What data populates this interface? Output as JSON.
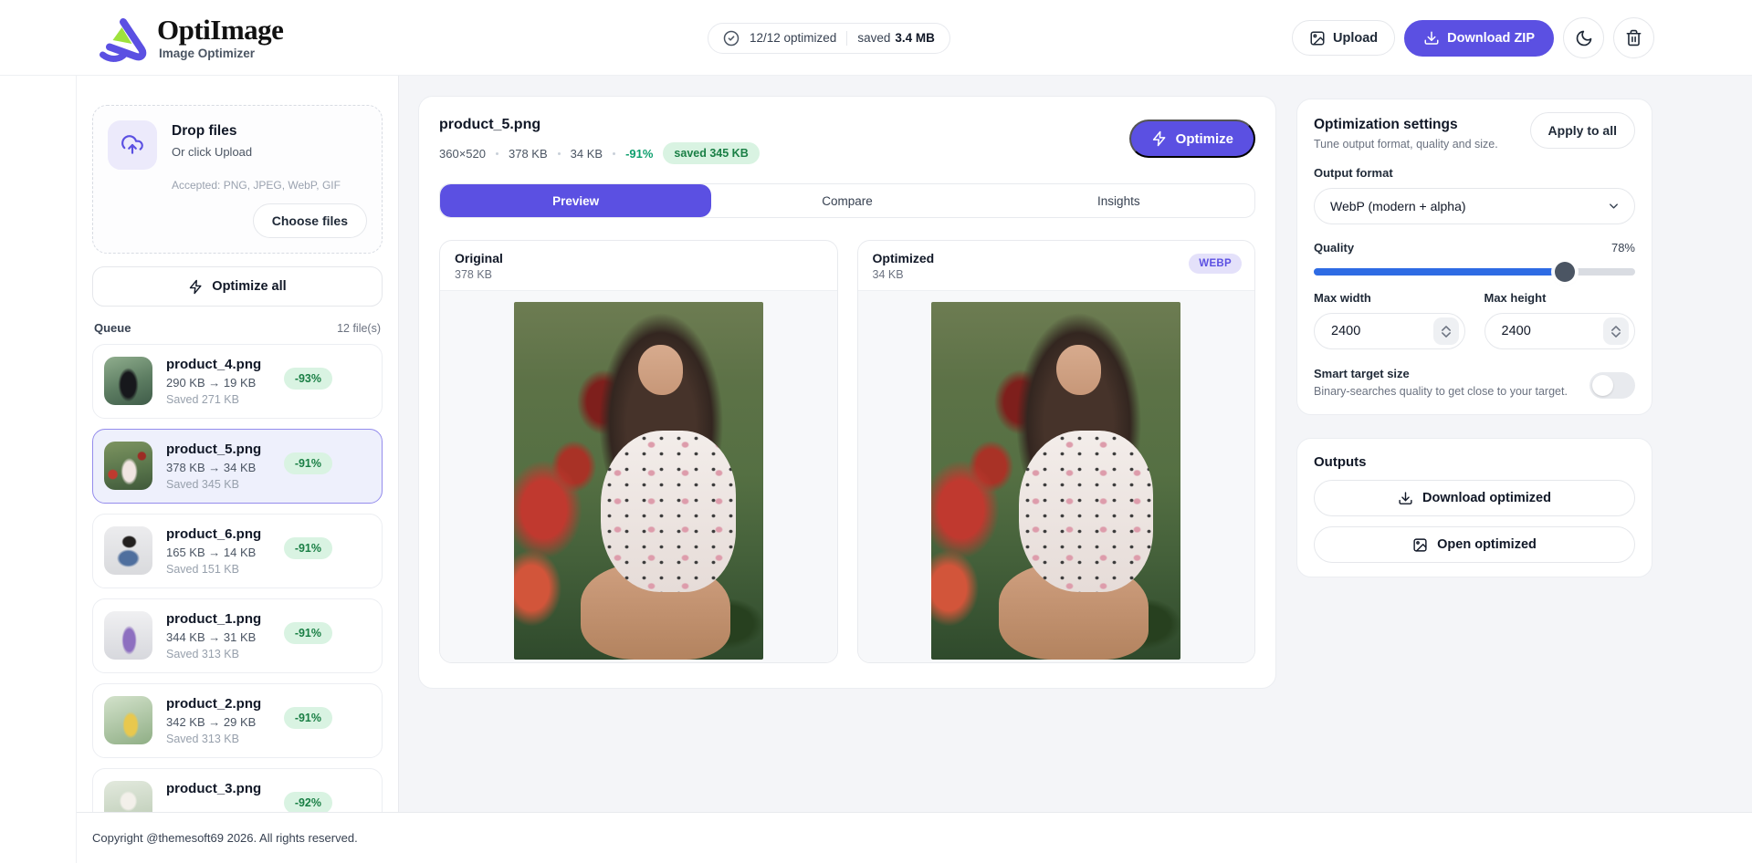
{
  "css_vars": {
    "accent": "#5b50e2",
    "slider-blue": "#2e6be4",
    "green-bg": "#d9f3e2",
    "green-text": "#1a7f45",
    "quality-fill": "78%"
  },
  "header": {
    "logo_title": "OptiImage",
    "logo_subtitle": "Image Optimizer",
    "status_optimized": "12/12 optimized",
    "status_saved_label": "saved",
    "status_saved_value": "3.4 MB",
    "upload_label": "Upload",
    "download_zip_label": "Download ZIP"
  },
  "sidebar": {
    "dropzone": {
      "title": "Drop files",
      "subtitle": "Or click Upload",
      "accepted": "Accepted: PNG, JPEG, WebP, GIF",
      "choose_label": "Choose files"
    },
    "optimize_all_label": "Optimize all",
    "queue": {
      "title": "Queue",
      "count": "12 file(s)",
      "items": [
        {
          "name": "product_4.png",
          "sizes": "290 KB → 19 KB",
          "saved": "Saved 271 KB",
          "badge": "-93%"
        },
        {
          "name": "product_5.png",
          "sizes": "378 KB → 34 KB",
          "saved": "Saved 345 KB",
          "badge": "-91%"
        },
        {
          "name": "product_6.png",
          "sizes": "165 KB → 14 KB",
          "saved": "Saved 151 KB",
          "badge": "-91%"
        },
        {
          "name": "product_1.png",
          "sizes": "344 KB → 31 KB",
          "saved": "Saved 313 KB",
          "badge": "-91%"
        },
        {
          "name": "product_2.png",
          "sizes": "342 KB → 29 KB",
          "saved": "Saved 313 KB",
          "badge": "-91%"
        },
        {
          "name": "product_3.png",
          "badge": "-92%"
        }
      ]
    }
  },
  "main": {
    "file_name": "product_5.png",
    "dimensions": "360×520",
    "original_size": "378 KB",
    "optimized_size": "34 KB",
    "reduction": "-91%",
    "saved_badge": "saved 345 KB",
    "optimize_label": "Optimize",
    "tabs": {
      "preview": "Preview",
      "compare": "Compare",
      "insights": "Insights"
    },
    "original_panel": {
      "title": "Original",
      "size": "378 KB"
    },
    "optimized_panel": {
      "title": "Optimized",
      "size": "34 KB",
      "format": "WEBP"
    }
  },
  "settings": {
    "title": "Optimization settings",
    "subtitle": "Tune output format, quality and size.",
    "apply_all_label": "Apply to all",
    "output_format_label": "Output format",
    "output_format_value": "WebP (modern + alpha)",
    "quality_label": "Quality",
    "quality_value": "78%",
    "max_width_label": "Max width",
    "max_width_value": "2400",
    "max_height_label": "Max height",
    "max_height_value": "2400",
    "smart_title": "Smart target size",
    "smart_desc": "Binary-searches quality to get close to your target."
  },
  "outputs": {
    "title": "Outputs",
    "download_label": "Download optimized",
    "open_label": "Open optimized"
  },
  "footer": {
    "copyright": "Copyright @themesoft69 2026. All rights reserved."
  }
}
